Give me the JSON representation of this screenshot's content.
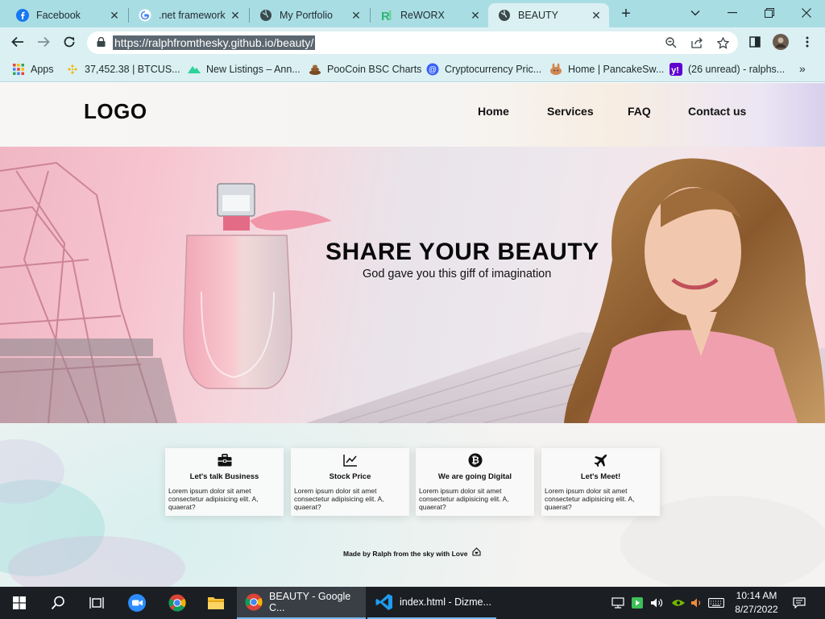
{
  "browser": {
    "tabs": [
      {
        "title": "Facebook",
        "icon": "facebook-icon"
      },
      {
        "title": ".net framework",
        "icon": "google-icon"
      },
      {
        "title": "My Portfolio",
        "icon": "globe-icon"
      },
      {
        "title": "ReWORX",
        "icon": "reworx-icon"
      },
      {
        "title": "BEAUTY",
        "icon": "globe-icon",
        "active": true
      }
    ],
    "url": "https://ralphfromthesky.github.io/beauty/",
    "bookmarks": [
      {
        "label": "Apps",
        "icon": "apps-grid-icon"
      },
      {
        "label": "37,452.38 | BTCUS...",
        "icon": "binance-icon"
      },
      {
        "label": "New Listings – Ann...",
        "icon": "coingecko-icon"
      },
      {
        "label": "PooCoin BSC Charts",
        "icon": "poocoin-icon"
      },
      {
        "label": "Cryptocurrency Pric...",
        "icon": "coinmarketcap-icon"
      },
      {
        "label": "Home | PancakeSw...",
        "icon": "pancakeswap-icon"
      },
      {
        "label": "(26 unread) - ralphs...",
        "icon": "yahoo-icon"
      }
    ],
    "colors": {
      "tabstrip": "#a9dde4",
      "toolbar": "#dbf0f3"
    }
  },
  "site": {
    "logo": "LOGO",
    "nav": [
      "Home",
      "Services",
      "FAQ",
      "Contact us"
    ],
    "hero": {
      "title": "SHARE YOUR BEAUTY",
      "subtitle": "God gave you this giff of imagination"
    },
    "cards": [
      {
        "title": "Let's talk Business",
        "text": "Lorem ipsum dolor sit amet consectetur adipisicing elit. A, quaerat?",
        "icon": "briefcase-icon"
      },
      {
        "title": "Stock Price",
        "text": "Lorem ipsum dolor sit amet consectetur adipisicing elit. A, quaerat?",
        "icon": "line-chart-icon"
      },
      {
        "title": "We are going Digital",
        "text": "Lorem ipsum dolor sit amet consectetur adipisicing elit. A, quaerat?",
        "icon": "bitcoin-icon"
      },
      {
        "title": "Let's Meet!",
        "text": "Lorem ipsum dolor sit amet consectetur adipisicing elit. A, quaerat?",
        "icon": "airplane-icon"
      }
    ],
    "footer": "Made by Ralph from the sky with Love"
  },
  "taskbar": {
    "apps": [
      {
        "label": "BEAUTY - Google C...",
        "icon": "chrome-icon"
      },
      {
        "label": "index.html - Dizme...",
        "icon": "vscode-icon"
      }
    ],
    "time": "10:14 AM",
    "date": "8/27/2022"
  }
}
